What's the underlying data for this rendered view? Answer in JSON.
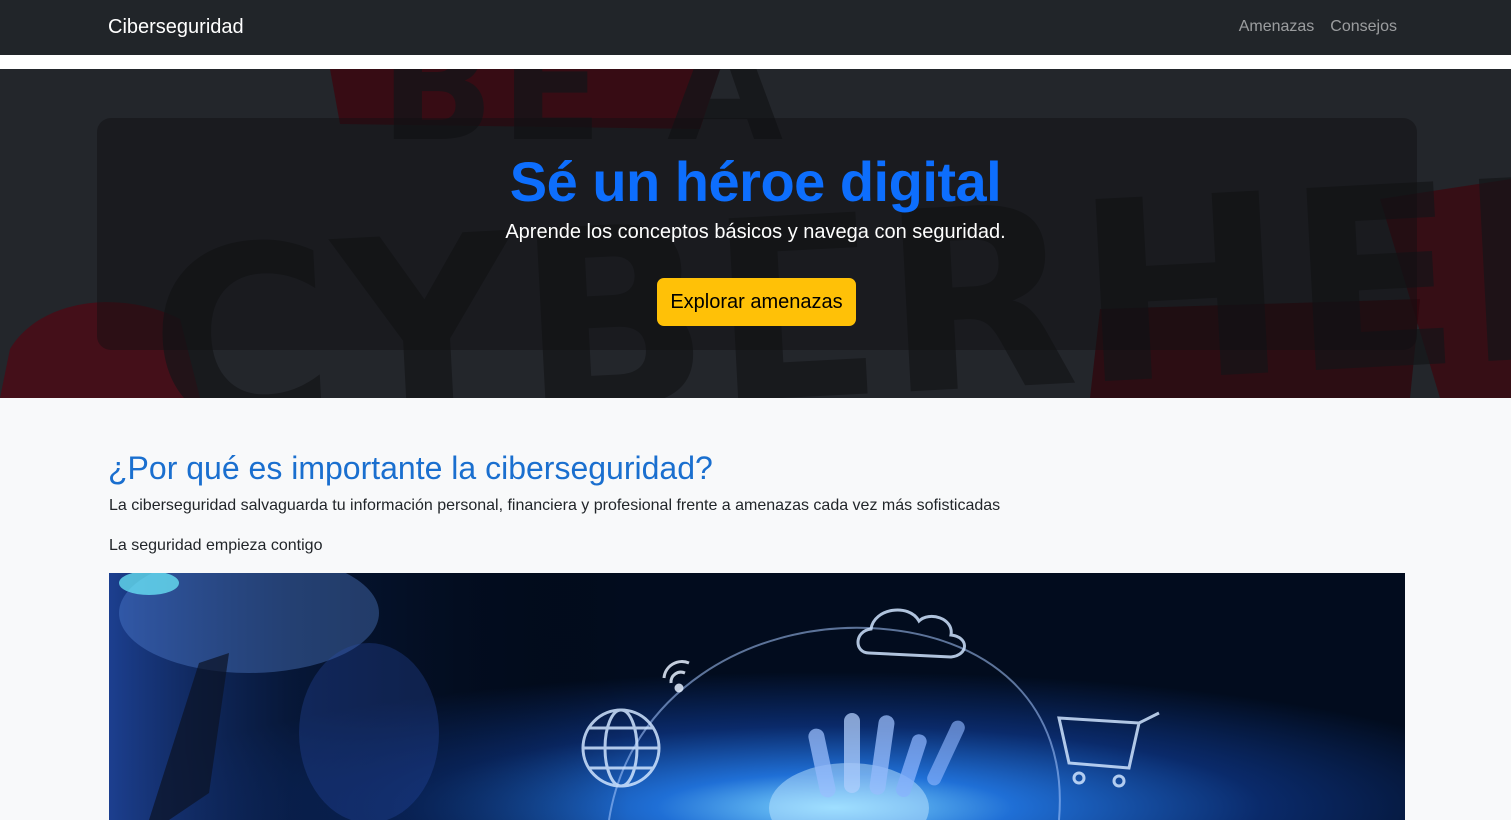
{
  "navbar": {
    "brand": "Ciberseguridad",
    "links": [
      {
        "label": "Amenazas"
      },
      {
        "label": "Consejos"
      }
    ]
  },
  "hero": {
    "title": "Sé un héroe digital",
    "subtitle": "Aprende los conceptos básicos y navega con seguridad.",
    "button_label": "Explorar amenazas",
    "bg_lettering": "BE A CYBERHERO!",
    "accent_color": "#0d6efd",
    "button_color": "#ffc107"
  },
  "section": {
    "title": "¿Por qué es importante la ciberseguridad?",
    "paragraph_1": "La ciberseguridad salvaguarda tu información personal, financiera y profesional frente a amenazas cada vez más sofisticadas",
    "paragraph_2": "La seguridad empieza contigo",
    "image_icons": [
      "hand-icon",
      "globe-icon",
      "cloud-icon",
      "wifi-icon",
      "cart-icon"
    ]
  }
}
